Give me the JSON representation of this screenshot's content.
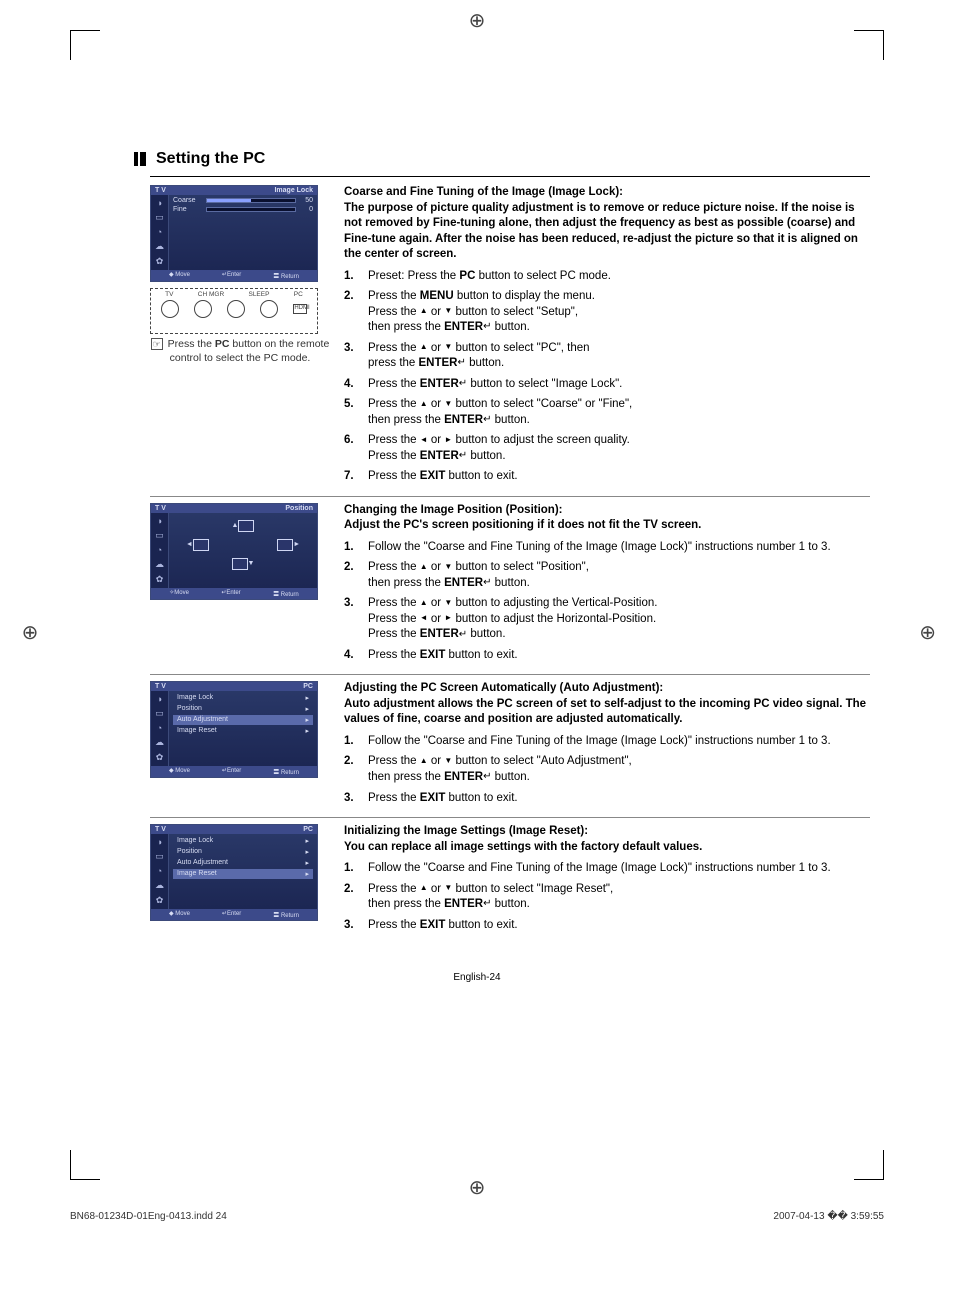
{
  "title": "Setting the PC",
  "osd_image_lock": {
    "tv_label": "T V",
    "header": "Image Lock",
    "rows": [
      {
        "label": "Coarse",
        "value": "50",
        "fill": 50
      },
      {
        "label": "Fine",
        "value": "0",
        "fill": 0
      }
    ],
    "footer": {
      "move": "◆ Move",
      "enter": "↵Enter",
      "return": "〓 Return"
    }
  },
  "remote": {
    "labels": [
      "TV",
      "CH MGR",
      "SLEEP",
      "PC"
    ],
    "note_hand": "☞",
    "note": "Press the PC button on the remote control to select the PC mode."
  },
  "section1": {
    "heading": "Coarse and Fine Tuning of the Image (Image Lock):",
    "intro": "The purpose of picture quality adjustment is to remove or reduce picture noise. If the noise is not removed by Fine-tuning alone, then adjust the frequency as best as possible (coarse) and Fine-tune again. After the noise has been reduced, re-adjust the picture so that it is aligned on the center of screen.",
    "steps": [
      "Preset: Press the <b>PC</b> button to select PC mode.",
      "Press the <b>MENU</b> button to display the menu.<br>Press the <span class='tri'>▲</span> or <span class='tri'>▼</span> button to select \"Setup\",<br>then press the <b>ENTER</b><span class='enter-icon'>↵</span> button.",
      "Press the <span class='tri'>▲</span> or <span class='tri'>▼</span> button to select \"PC\", then<br>press the <b>ENTER</b><span class='enter-icon'>↵</span> button.",
      "Press the <b>ENTER</b><span class='enter-icon'>↵</span> button to select \"Image Lock\".",
      "Press the <span class='tri'>▲</span> or <span class='tri'>▼</span> button to select \"Coarse\" or \"Fine\",<br>then press the <b>ENTER</b><span class='enter-icon'>↵</span> button.",
      "Press the <span class='tri'>◄</span> or <span class='tri'>►</span> button to adjust the screen quality.<br>Press the <b>ENTER</b><span class='enter-icon'>↵</span> button.",
      "Press the <b>EXIT</b> button to exit."
    ]
  },
  "osd_position": {
    "tv_label": "T V",
    "header": "Position",
    "footer": {
      "move": "✧Move",
      "enter": "↵Enter",
      "return": "〓 Return"
    }
  },
  "section2": {
    "heading": "Changing the Image Position (Position):",
    "intro": "Adjust the PC's screen positioning if it does not fit the TV screen.",
    "steps": [
      "Follow the \"Coarse and Fine Tuning of the Image (Image Lock)\" instructions number 1 to 3.",
      "Press the <span class='tri'>▲</span> or <span class='tri'>▼</span> button to select \"Position\",<br>then press the <b>ENTER</b><span class='enter-icon'>↵</span> button.",
      "Press the <span class='tri'>▲</span> or <span class='tri'>▼</span> button to adjusting the Vertical-Position.<br>Press the <span class='tri'>◄</span> or <span class='tri'>►</span> button to adjust the Horizontal-Position.<br>Press the <b>ENTER</b><span class='enter-icon'>↵</span> button.",
      "Press the <b>EXIT</b> button to exit."
    ]
  },
  "osd_pc1": {
    "tv_label": "T V",
    "header": "PC",
    "items": [
      "Image Lock",
      "Position",
      "Auto Adjustment",
      "Image Reset"
    ],
    "selected_index": 2,
    "footer": {
      "move": "◆ Move",
      "enter": "↵Enter",
      "return": "〓 Return"
    }
  },
  "section3": {
    "heading": "Adjusting the PC Screen Automatically (Auto Adjustment):",
    "intro": "Auto adjustment allows the PC screen of set to self-adjust to the incoming PC video signal. The values of fine, coarse and position are adjusted automatically.",
    "steps": [
      "Follow the \"Coarse and Fine Tuning of the Image (Image Lock)\" instructions number 1 to 3.",
      "Press the <span class='tri'>▲</span> or <span class='tri'>▼</span> button to select \"Auto Adjustment\",<br>then press the <b>ENTER</b><span class='enter-icon'>↵</span> button.",
      "Press the <b>EXIT</b> button to exit."
    ]
  },
  "osd_pc2": {
    "tv_label": "T V",
    "header": "PC",
    "items": [
      "Image Lock",
      "Position",
      "Auto Adjustment",
      "Image Reset"
    ],
    "selected_index": 3,
    "footer": {
      "move": "◆ Move",
      "enter": "↵Enter",
      "return": "〓 Return"
    }
  },
  "section4": {
    "heading": "Initializing the Image Settings (Image Reset):",
    "intro": "You can replace all image settings with the factory default values.",
    "steps": [
      "Follow the \"Coarse and Fine Tuning of the Image (Image Lock)\" instructions number 1 to 3.",
      "Press the <span class='tri'>▲</span> or <span class='tri'>▼</span> button to select \"Image Reset\",<br>then press the <b>ENTER</b><span class='enter-icon'>↵</span> button.",
      "Press the <b>EXIT</b> button to exit."
    ]
  },
  "page_number": "English-24",
  "print_left": "BN68-01234D-01Eng-0413.indd   24",
  "print_right": "2007-04-13   �� 3:59:55"
}
